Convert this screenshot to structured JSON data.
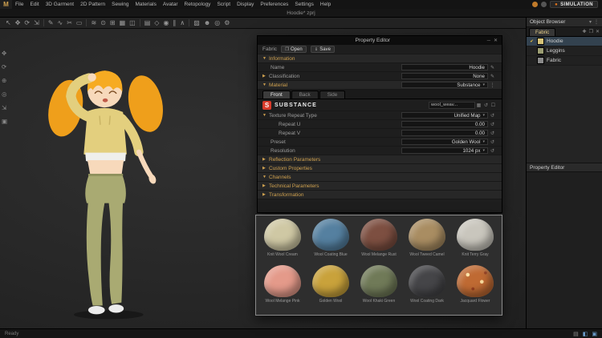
{
  "colors": {
    "accent": "#cfa14f",
    "simulation_dot": "#e8751a",
    "substance_red": "#d83a2a",
    "selection": "#33424f"
  },
  "icons": {
    "caret_down": "▼",
    "caret_right": "▶",
    "dropdown": "▾",
    "pencil": "✎",
    "close": "✕",
    "check": "✔",
    "reset": "↺",
    "open": "❐",
    "save": "⇓",
    "dot": "●",
    "image": "▦",
    "checkbox": "☐",
    "plus": "✚",
    "dots": "⋮",
    "minimize": "─",
    "collapse": "▾"
  },
  "app": {
    "logo_letter": "M",
    "window_title": "Hoodie* zprj",
    "simulation_label": "SIMULATION"
  },
  "menu": {
    "items": [
      "File",
      "Edit",
      "3D Garment",
      "2D Pattern",
      "Sewing",
      "Materials",
      "Avatar",
      "Retopology",
      "Script",
      "Display",
      "Preferences",
      "Settings",
      "Help"
    ]
  },
  "toolbar": {
    "icons": [
      {
        "name": "select-icon",
        "glyph": "↖"
      },
      {
        "name": "move-icon",
        "glyph": "✥"
      },
      {
        "name": "rotate-icon",
        "glyph": "⟳"
      },
      {
        "name": "scale-icon",
        "glyph": "⇲"
      },
      {
        "name": "pen-icon",
        "glyph": "✎"
      },
      {
        "name": "curve-icon",
        "glyph": "∿"
      },
      {
        "name": "scissors-icon",
        "glyph": "✂"
      },
      {
        "name": "tape-icon",
        "glyph": "▭"
      },
      {
        "name": "sewing-icon",
        "glyph": "≋"
      },
      {
        "name": "pin-icon",
        "glyph": "⊙"
      },
      {
        "name": "grid-icon",
        "glyph": "⊞"
      },
      {
        "name": "pattern-icon",
        "glyph": "▦"
      },
      {
        "name": "mirror-icon",
        "glyph": "◫"
      },
      {
        "name": "measure-icon",
        "glyph": "▤"
      },
      {
        "name": "dart-icon",
        "glyph": "◇"
      },
      {
        "name": "button-icon",
        "glyph": "◉"
      },
      {
        "name": "zipper-icon",
        "glyph": "∥"
      },
      {
        "name": "fold-icon",
        "glyph": "∧"
      },
      {
        "name": "texture-icon",
        "glyph": "▨"
      },
      {
        "name": "avatar-icon",
        "glyph": "☻"
      },
      {
        "name": "camera-icon",
        "glyph": "◎"
      },
      {
        "name": "settings-icon",
        "glyph": "⚙"
      }
    ]
  },
  "side_tools": {
    "icons": [
      {
        "name": "pan-icon",
        "glyph": "✥"
      },
      {
        "name": "orbit-icon",
        "glyph": "⟳"
      },
      {
        "name": "zoom-icon",
        "glyph": "⊕"
      },
      {
        "name": "focus-icon",
        "glyph": "◎"
      },
      {
        "name": "gizmo-icon",
        "glyph": "⇲"
      },
      {
        "name": "home-icon",
        "glyph": "▣"
      }
    ]
  },
  "property_editor": {
    "title": "Property Editor",
    "fabric": {
      "label": "Fabric",
      "open": "Open",
      "save": "Save"
    },
    "information": {
      "header": "Information",
      "name_label": "Name",
      "name_value": "Hoodie",
      "classification_label": "Classification",
      "classification_value": "None"
    },
    "material": {
      "header": "Material",
      "type_value": "Substance",
      "tabs": [
        "Front",
        "Back",
        "Side"
      ],
      "brand": "SUBSTANCE",
      "texture_name": "wool_weav...",
      "rows": {
        "texture_repeat_type": {
          "label": "Texture Repeat Type",
          "value": "Unified Map"
        },
        "repeat_u": {
          "label": "Repeat U",
          "value": "0.00"
        },
        "repeat_v": {
          "label": "Repeat V",
          "value": "0.00"
        },
        "preset": {
          "label": "Preset",
          "value": "Golden Wool"
        },
        "resolution": {
          "label": "Resolution",
          "value": "1024 px"
        }
      },
      "collapsed": [
        "Reflection Parameters",
        "Custom Properties"
      ]
    },
    "channels": {
      "header": "Channels",
      "collapsed": [
        "Technical Parameters",
        "Transformation"
      ]
    }
  },
  "presets_panel": {
    "items": [
      {
        "name": "Knit Wool Cream",
        "color": "#cfc8a4"
      },
      {
        "name": "Wool Coating Blue",
        "color": "#5580a0"
      },
      {
        "name": "Wool Melange Rust",
        "color": "#7d4f41"
      },
      {
        "name": "Wool Tweed Camel",
        "color": "#a98d62"
      },
      {
        "name": "Knit Terry Gray",
        "color": "#c9c6bd"
      },
      {
        "name": "Wool Melange Pink",
        "color": "#e49a8a"
      },
      {
        "name": "Golden Wool",
        "color": "#c9a23b"
      },
      {
        "name": "Wool Khaki Green",
        "color": "#707a58"
      },
      {
        "name": "Wool Coating Dark",
        "color": "#454548"
      },
      {
        "name": "Jacquard Flower",
        "color": "#bf6a33"
      }
    ]
  },
  "object_browser": {
    "title": "Object Browser",
    "tab_label": "Fabric",
    "items": [
      {
        "name": "Hoodie",
        "color": "#d6c478"
      },
      {
        "name": "Leggins",
        "color": "#9a9c72"
      },
      {
        "name": "Fabric",
        "color": "#8a8a8a"
      }
    ],
    "property_editor_title": "Property Editor"
  },
  "statusbar": {
    "left_text": "Ready",
    "icons": [
      {
        "name": "grid-view-icon",
        "glyph": "▤"
      },
      {
        "name": "split-view-icon",
        "glyph": "◧"
      },
      {
        "name": "panel-icon",
        "glyph": "▣"
      }
    ]
  }
}
